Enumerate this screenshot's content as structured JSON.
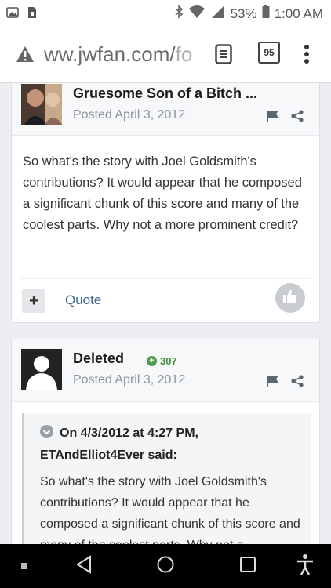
{
  "status": {
    "battery": "53%",
    "time": "1:00 AM"
  },
  "browser": {
    "url_main": "ww.jwfan.com/",
    "url_fade": "fo",
    "tab_count": "95"
  },
  "posts": [
    {
      "author": "Gruesome Son of a Bitch",
      "author_suffix": " ...",
      "posted": "Posted April 3, 2012",
      "body": "So what's the story with Joel Goldsmith's contributions? It would appear that he composed a significant chunk of this score and many of the coolest parts. Why not a more prominent credit?",
      "quote_label": "Quote"
    },
    {
      "author": "Deleted",
      "reputation": "307",
      "posted": "Posted April 3, 2012",
      "quote_header_line1": "On 4/3/2012 at 4:27 PM,",
      "quote_header_line2": "ETAndElliot4Ever said:",
      "quote_body": "So what's the story with Joel Goldsmith's contributions? It would appear that he composed a significant chunk of this score and many of the coolest parts. Why not a"
    }
  ],
  "colors": {
    "accent": "#3d6594",
    "reputation": "#3c8a3c",
    "meta": "#8b94a1"
  }
}
